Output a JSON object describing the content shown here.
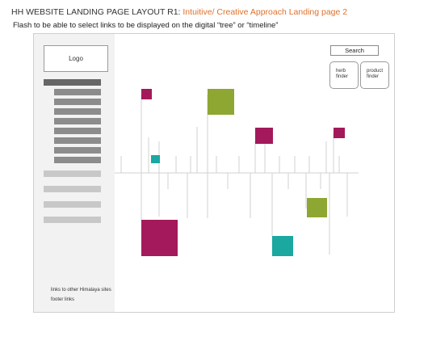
{
  "header": {
    "title": "HH WEBSITE LANDING PAGE LAYOUT R1:",
    "title_highlight": "Intuitive/ Creative Approach Landing page 2",
    "subtitle": "Flash to be able to select links to be displayed on the digital “tree” or “timeline”"
  },
  "sidebar": {
    "logo_label": "Logo",
    "nav_items": [
      {
        "level": "primary",
        "color": "#666666"
      },
      {
        "level": "sub",
        "color": "#8c8c8c"
      },
      {
        "level": "sub",
        "color": "#8c8c8c"
      },
      {
        "level": "sub",
        "color": "#8c8c8c"
      },
      {
        "level": "sub",
        "color": "#8c8c8c"
      },
      {
        "level": "sub",
        "color": "#8c8c8c"
      },
      {
        "level": "sub",
        "color": "#8c8c8c"
      },
      {
        "level": "sub",
        "color": "#8c8c8c"
      },
      {
        "level": "sub",
        "color": "#8c8c8c"
      },
      {
        "level": "secondary",
        "color": "#c8c8c8"
      },
      {
        "level": "secondary",
        "color": "#c8c8c8"
      },
      {
        "level": "secondary",
        "color": "#c8c8c8"
      },
      {
        "level": "secondary",
        "color": "#c8c8c8"
      }
    ],
    "footer_links_text": "links to other Himalaya sites",
    "footer_text": "footer links"
  },
  "search": {
    "label": "Search"
  },
  "finders": [
    {
      "line1": "herb",
      "line2": "finder"
    },
    {
      "line1": "product",
      "line2": "finder"
    }
  ],
  "colors": {
    "magenta": "#a3195b",
    "green": "#8ea632",
    "teal": "#1aa8a0",
    "timeline_line": "#d0d0d0",
    "accent_orange": "#e0712c"
  }
}
